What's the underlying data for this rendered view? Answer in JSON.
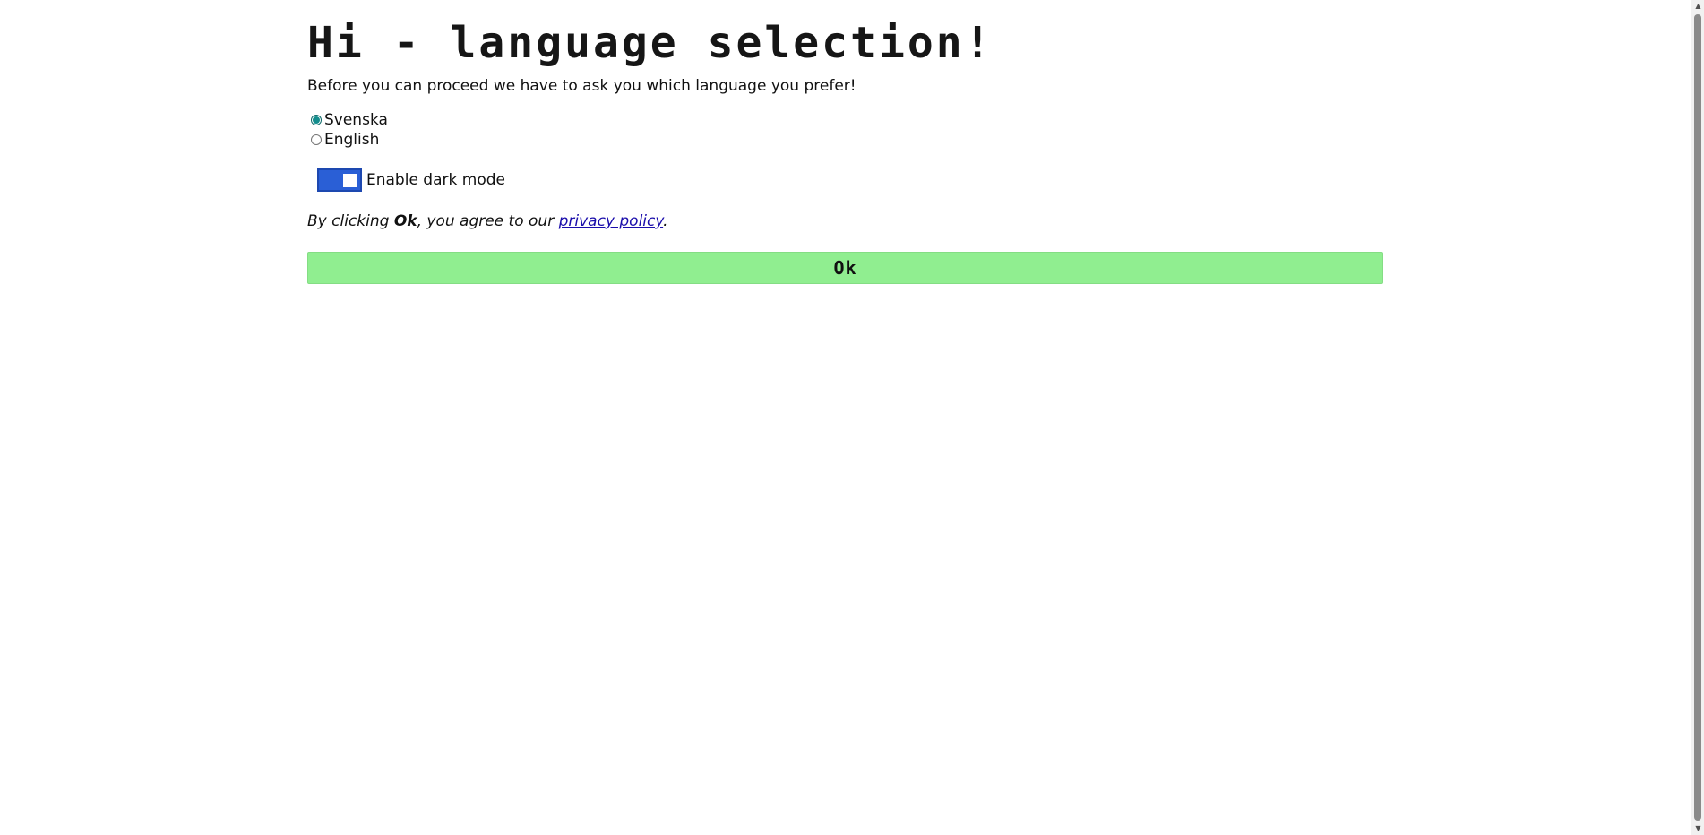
{
  "heading": "Hi - language selection!",
  "intro": "Before you can proceed we have to ask you which language you prefer!",
  "languages": {
    "selected": "Svenska",
    "options": [
      {
        "label": "Svenska",
        "checked": true
      },
      {
        "label": "English",
        "checked": false
      }
    ]
  },
  "dark_mode": {
    "label": "Enable dark mode",
    "enabled": true,
    "color": "#2a5fd6"
  },
  "agreement": {
    "prefix": "By clicking ",
    "bold": "Ok",
    "middle": ", you agree to our ",
    "link": "privacy policy",
    "suffix": "."
  },
  "ok_button": {
    "label": "Ok",
    "color": "#90ee90"
  },
  "icons": {
    "scroll_up": "chevron-up-icon",
    "scroll_down": "chevron-down-icon"
  }
}
